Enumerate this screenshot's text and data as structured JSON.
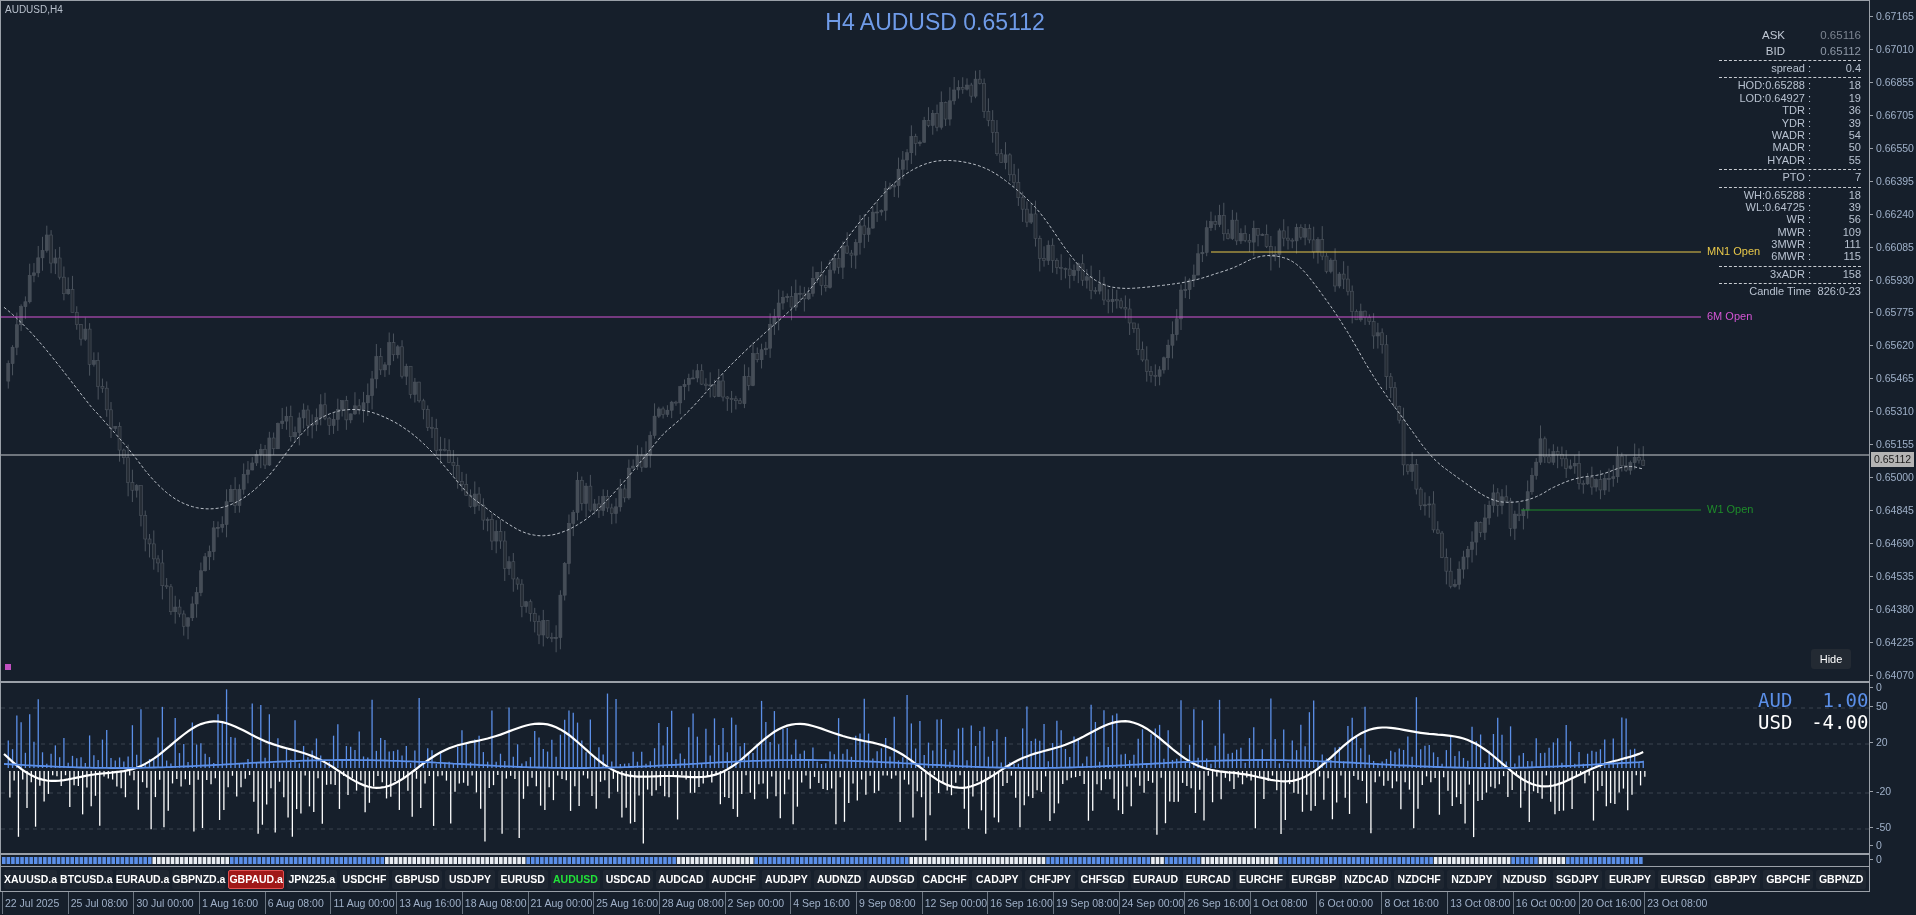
{
  "chart": {
    "symbol_label": "AUDUSD,H4",
    "title": "H4 AUDUSD 0.65112",
    "price_axis": [
      "0.67165",
      "0.67010",
      "0.66855",
      "0.66705",
      "0.66550",
      "0.66395",
      "0.66240",
      "0.66085",
      "0.65930",
      "0.65775",
      "0.65620",
      "0.65465",
      "0.65310",
      "0.65155",
      "0.65000",
      "0.64845",
      "0.64690",
      "0.64535",
      "0.64380",
      "0.64225",
      "0.64070"
    ],
    "current_price": "0.65112",
    "levels": [
      {
        "label": "MN1 Open",
        "color": "#e8c84a"
      },
      {
        "label": "6M Open",
        "color": "#d455d4"
      },
      {
        "label": "W1 Open",
        "color": "#1e8c2a"
      }
    ],
    "info": {
      "ask_label": "ASK",
      "ask": "0.65116",
      "bid_label": "BID",
      "bid": "0.65112",
      "sections": [
        [
          {
            "label": "spread :",
            "value": "0.4"
          }
        ],
        [
          {
            "label": "HOD:0.65288 :",
            "value": "18"
          },
          {
            "label": "LOD:0.64927 :",
            "value": "19"
          },
          {
            "label": "TDR :",
            "value": "36"
          },
          {
            "label": "YDR :",
            "value": "39"
          },
          {
            "label": "WADR :",
            "value": "54"
          },
          {
            "label": "MADR :",
            "value": "50"
          },
          {
            "label": "HYADR :",
            "value": "55"
          }
        ],
        [
          {
            "label": "PTO :",
            "value": "7"
          }
        ],
        [
          {
            "label": "WH:0.65288 :",
            "value": "18"
          },
          {
            "label": "WL:0.64725 :",
            "value": "39"
          },
          {
            "label": "WR :",
            "value": "56"
          },
          {
            "label": "MWR :",
            "value": "109"
          },
          {
            "label": "3MWR :",
            "value": "111"
          },
          {
            "label": "6MWR :",
            "value": "115"
          }
        ],
        [
          {
            "label": "3xADR :",
            "value": "158"
          }
        ],
        [
          {
            "label": "Candle Time",
            "value": "826:0-23"
          }
        ]
      ]
    },
    "hide_button": "Hide"
  },
  "indicator": {
    "axis": [
      "0",
      "50",
      "20",
      "-20",
      "-50",
      "0"
    ],
    "currencies": [
      {
        "name": "AUD",
        "value": "1.00",
        "color": "#5b8fe8"
      },
      {
        "name": "USD",
        "value": "-4.00",
        "color": "#ffffff"
      }
    ]
  },
  "strip": {
    "axis": "0"
  },
  "symbols": [
    {
      "label": "XAUUSD.a",
      "selected": false,
      "active": false
    },
    {
      "label": "BTCUSD.a",
      "selected": false,
      "active": false
    },
    {
      "label": "EURAUD.a",
      "selected": false,
      "active": false
    },
    {
      "label": "GBPNZD.a",
      "selected": false,
      "active": false
    },
    {
      "label": "GBPAUD.a",
      "selected": true,
      "active": false
    },
    {
      "label": "JPN225.a",
      "selected": false,
      "active": false
    },
    {
      "label": "USDCHF",
      "selected": false,
      "active": false
    },
    {
      "label": "GBPUSD",
      "selected": false,
      "active": false
    },
    {
      "label": "USDJPY",
      "selected": false,
      "active": false
    },
    {
      "label": "EURUSD",
      "selected": false,
      "active": false
    },
    {
      "label": "AUDUSD",
      "selected": false,
      "active": true
    },
    {
      "label": "USDCAD",
      "selected": false,
      "active": false
    },
    {
      "label": "AUDCAD",
      "selected": false,
      "active": false
    },
    {
      "label": "AUDCHF",
      "selected": false,
      "active": false
    },
    {
      "label": "AUDJPY",
      "selected": false,
      "active": false
    },
    {
      "label": "AUDNZD",
      "selected": false,
      "active": false
    },
    {
      "label": "AUDSGD",
      "selected": false,
      "active": false
    },
    {
      "label": "CADCHF",
      "selected": false,
      "active": false
    },
    {
      "label": "CADJPY",
      "selected": false,
      "active": false
    },
    {
      "label": "CHFJPY",
      "selected": false,
      "active": false
    },
    {
      "label": "CHFSGD",
      "selected": false,
      "active": false
    },
    {
      "label": "EURAUD",
      "selected": false,
      "active": false
    },
    {
      "label": "EURCAD",
      "selected": false,
      "active": false
    },
    {
      "label": "EURCHF",
      "selected": false,
      "active": false
    },
    {
      "label": "EURGBP",
      "selected": false,
      "active": false
    },
    {
      "label": "NZDCAD",
      "selected": false,
      "active": false
    },
    {
      "label": "NZDCHF",
      "selected": false,
      "active": false
    },
    {
      "label": "NZDJPY",
      "selected": false,
      "active": false
    },
    {
      "label": "NZDUSD",
      "selected": false,
      "active": false
    },
    {
      "label": "SGDJPY",
      "selected": false,
      "active": false
    },
    {
      "label": "EURJPY",
      "selected": false,
      "active": false
    },
    {
      "label": "EURSGD",
      "selected": false,
      "active": false
    },
    {
      "label": "GBPJPY",
      "selected": false,
      "active": false
    },
    {
      "label": "GBPCHF",
      "selected": false,
      "active": false
    },
    {
      "label": "GBPNZD",
      "selected": false,
      "active": false
    }
  ],
  "time_axis": [
    "22 Jul 2025",
    "25 Jul 08:00",
    "30 Jul 00:00",
    "1 Aug 16:00",
    "6 Aug 08:00",
    "11 Aug 00:00",
    "13 Aug 16:00",
    "18 Aug 08:00",
    "21 Aug 00:00",
    "25 Aug 16:00",
    "28 Aug 08:00",
    "2 Sep 00:00",
    "4 Sep 16:00",
    "9 Sep 08:00",
    "12 Sep 00:00",
    "16 Sep 16:00",
    "19 Sep 08:00",
    "24 Sep 00:00",
    "26 Sep 16:00",
    "1 Oct 08:00",
    "6 Oct 00:00",
    "8 Oct 16:00",
    "13 Oct 08:00",
    "16 Oct 00:00",
    "20 Oct 16:00",
    "23 Oct 08:00"
  ]
}
